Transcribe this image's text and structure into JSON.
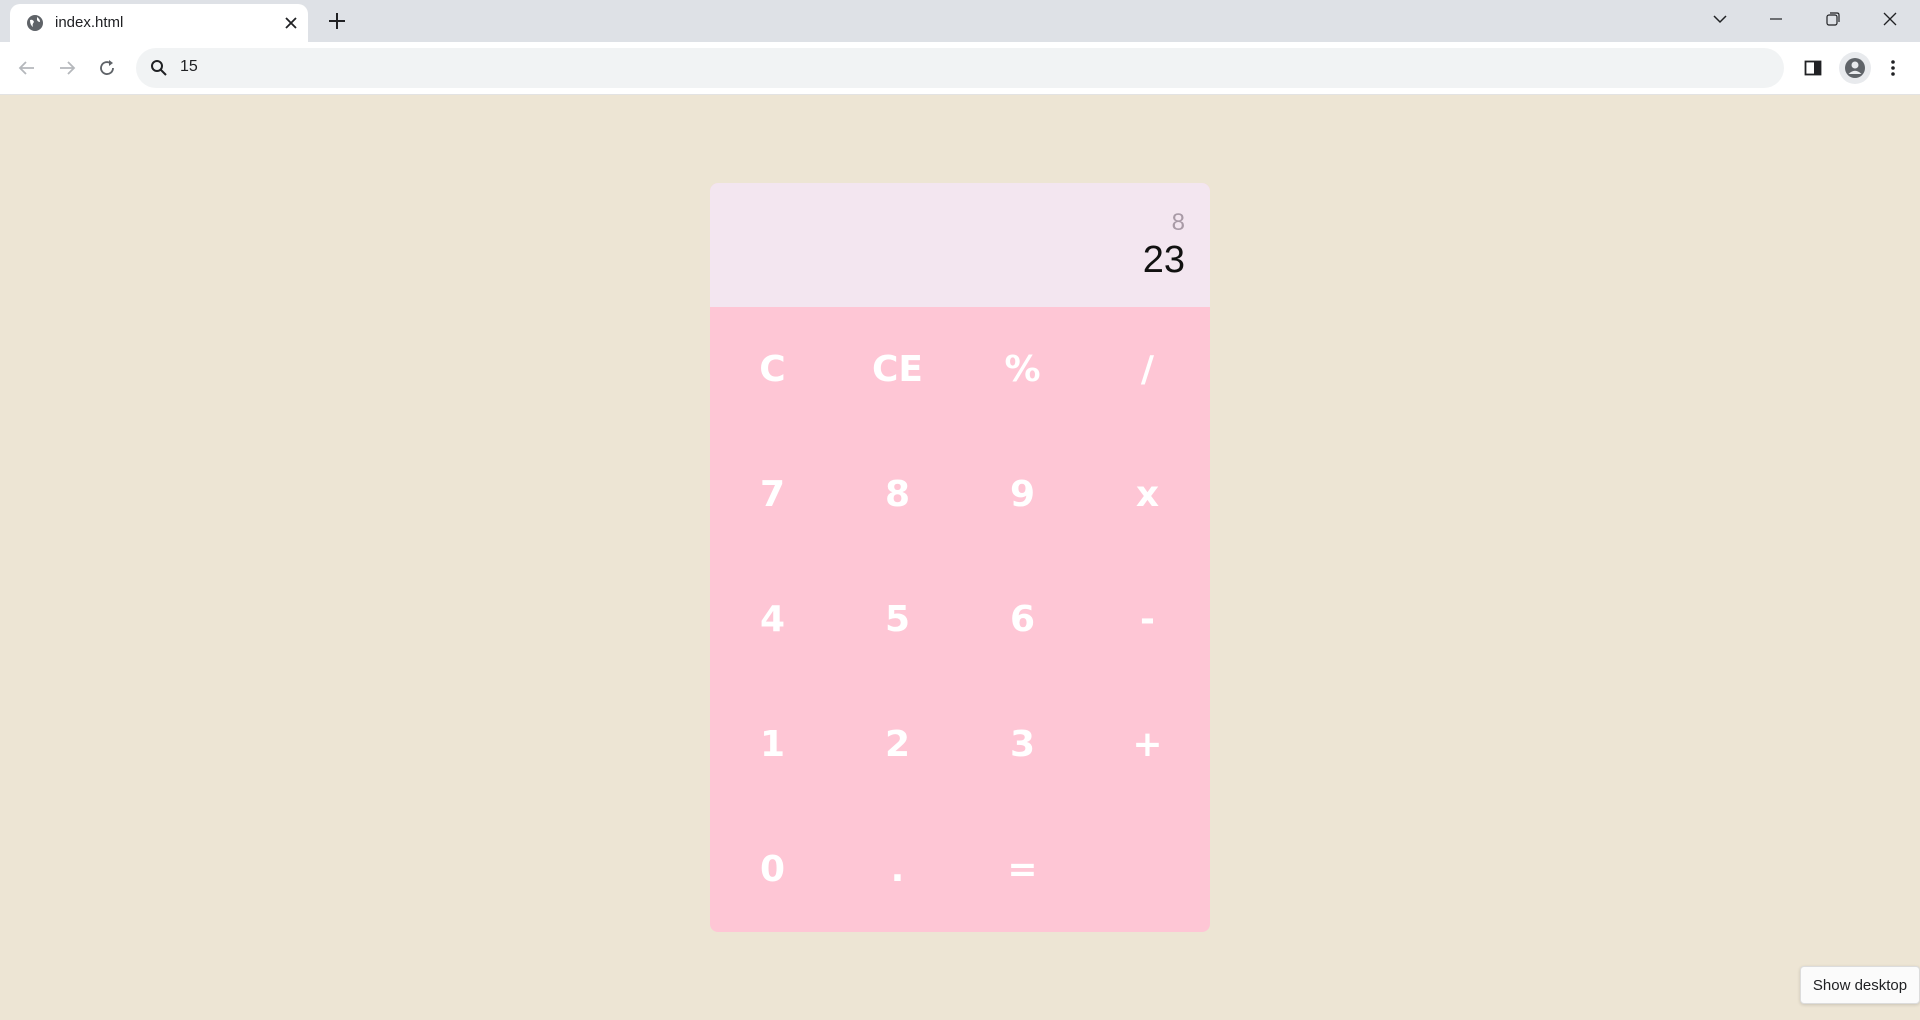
{
  "browser": {
    "tab": {
      "title": "index.html",
      "favicon": "globe-icon"
    },
    "omnibox": {
      "text": "15"
    }
  },
  "calculator": {
    "display": {
      "previous": "8",
      "current": "23"
    },
    "keys": [
      "C",
      "CE",
      "%",
      "/",
      "7",
      "8",
      "9",
      "x",
      "4",
      "5",
      "6",
      "-",
      "1",
      "2",
      "3",
      "+",
      "0",
      ".",
      "="
    ]
  },
  "tooltip": {
    "text": "Show desktop"
  },
  "colors": {
    "page_background": "#ede5d4",
    "display_background": "#f3e6f0",
    "keypad_background": "#fec6d5",
    "key_text": "#ffffff"
  }
}
